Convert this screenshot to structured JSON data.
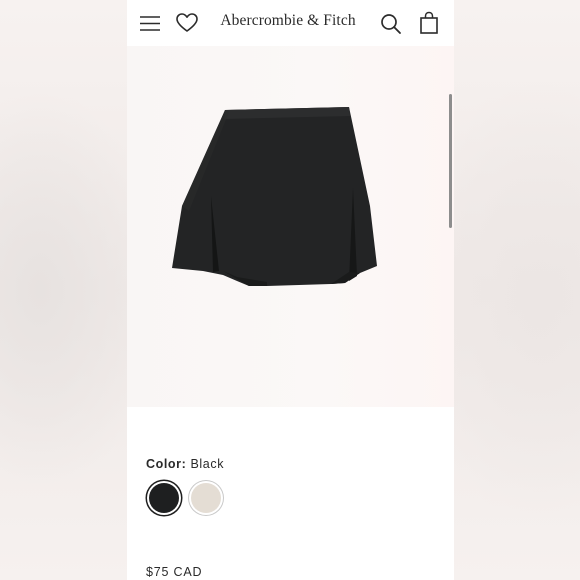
{
  "header": {
    "brand": "Abercrombie & Fitch",
    "icons": [
      "menu-icon",
      "heart-icon",
      "search-icon",
      "shopping-bag-icon"
    ]
  },
  "product": {
    "image_subject": "black pleated mini skirt",
    "color_label": "Color:",
    "color_value": "Black",
    "swatches": [
      {
        "name": "Black",
        "hex": "#1e1f20",
        "selected": true
      },
      {
        "name": "Cream",
        "hex": "#e4ddd4",
        "selected": false
      }
    ],
    "price": "$75 CAD"
  },
  "colors": {
    "page_background": "#f3eeec",
    "text": "#2a2a2a",
    "skirt": "#232425"
  }
}
